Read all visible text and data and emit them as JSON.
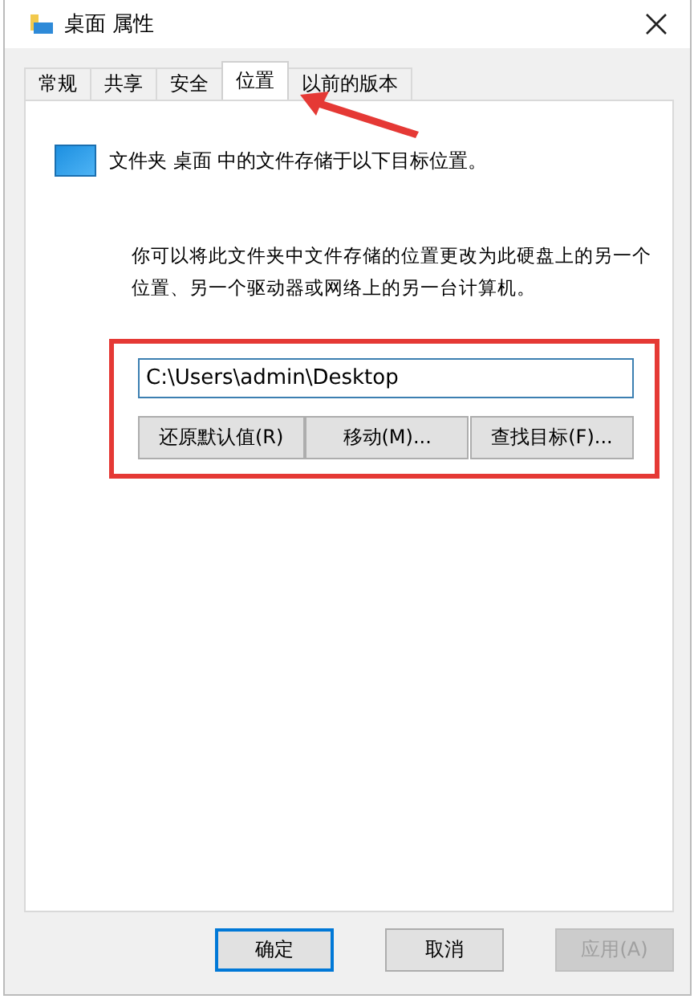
{
  "window": {
    "title": "桌面 属性"
  },
  "tabs": [
    {
      "label": "常规",
      "selected": false
    },
    {
      "label": "共享",
      "selected": false
    },
    {
      "label": "安全",
      "selected": false
    },
    {
      "label": "位置",
      "selected": true
    },
    {
      "label": "以前的版本",
      "selected": false
    }
  ],
  "location_info": "文件夹 桌面 中的文件存储于以下目标位置。",
  "explanation": "你可以将此文件夹中文件存储的位置更改为此硬盘上的另一个位置、另一个驱动器或网络上的另一台计算机。",
  "path_field": {
    "value": "C:\\Users\\admin\\Desktop"
  },
  "location_buttons": [
    "还原默认值(R)",
    "移动(M)...",
    "查找目标(F)..."
  ],
  "dialog_buttons": [
    {
      "label": "确定",
      "default": true,
      "disabled": false
    },
    {
      "label": "取消",
      "default": false,
      "disabled": false
    },
    {
      "label": "应用(A)",
      "default": false,
      "disabled": true
    }
  ]
}
